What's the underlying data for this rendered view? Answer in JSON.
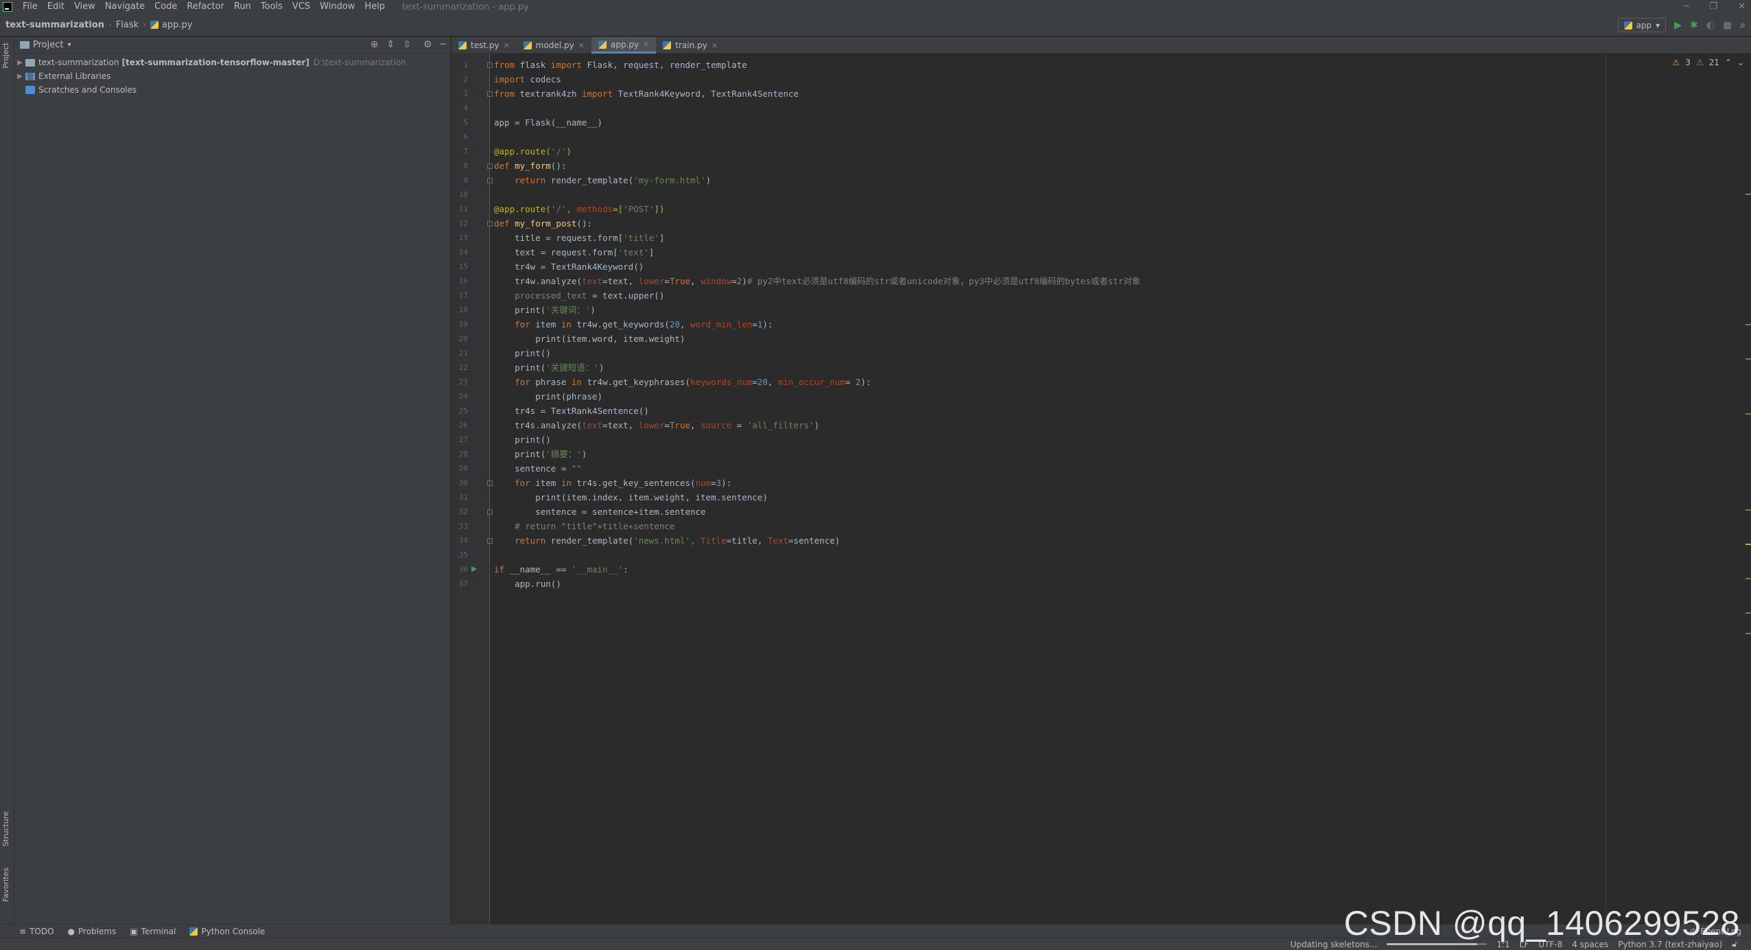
{
  "menu": {
    "items": [
      "File",
      "Edit",
      "View",
      "Navigate",
      "Code",
      "Refactor",
      "Run",
      "Tools",
      "VCS",
      "Window",
      "Help"
    ],
    "window_title": "text-summarization - app.py"
  },
  "navbar": {
    "project": "text-summarization",
    "folder": "Flask",
    "file": "app.py",
    "run_config": "app"
  },
  "side_tabs": {
    "project": "Project",
    "structure": "Structure",
    "favorites": "Favorites"
  },
  "project_panel": {
    "title": "Project",
    "tree": [
      {
        "name": "text-summarization",
        "bold": "[text-summarization-tensorflow-master]",
        "path": "D:\\text-summarization"
      },
      {
        "name": "External Libraries"
      },
      {
        "name": "Scratches and Consoles"
      }
    ]
  },
  "tabs": [
    {
      "label": "test.py",
      "active": false
    },
    {
      "label": "model.py",
      "active": false
    },
    {
      "label": "app.py",
      "active": true
    },
    {
      "label": "train.py",
      "active": false
    }
  ],
  "editor": {
    "warnings": "3",
    "weak_warnings": "21",
    "lines": [
      [
        [
          "from",
          "#cc7832"
        ],
        [
          " flask ",
          "#a9b7c6"
        ],
        [
          "import",
          "#cc7832"
        ],
        [
          " Flask, request, render_template",
          "#a9b7c6"
        ]
      ],
      [
        [
          "import",
          "#cc7832"
        ],
        [
          " codecs",
          "#a9b7c6"
        ]
      ],
      [
        [
          "from",
          "#cc7832"
        ],
        [
          " textrank4zh ",
          "#a9b7c6"
        ],
        [
          "import",
          "#cc7832"
        ],
        [
          " TextRank4Keyword, TextRank4Sentence",
          "#a9b7c6"
        ]
      ],
      [],
      [
        [
          "app = Flask(__name__)",
          "#a9b7c6"
        ]
      ],
      [],
      [
        [
          "@app.route(",
          "#bbb529"
        ],
        [
          "'/'",
          "#6a8759"
        ],
        [
          ")",
          "#bbb529"
        ]
      ],
      [
        [
          "def",
          "#cc7832"
        ],
        [
          " ",
          "#a9b7c6"
        ],
        [
          "my_form",
          "#ffc66d"
        ],
        [
          "():",
          "#a9b7c6"
        ]
      ],
      [
        [
          "    ",
          "#a9b7c6"
        ],
        [
          "return",
          "#cc7832"
        ],
        [
          " render_template(",
          "#a9b7c6"
        ],
        [
          "'my-form.html'",
          "#6a8759"
        ],
        [
          ")",
          "#a9b7c6"
        ]
      ],
      [],
      [
        [
          "@app.route(",
          "#bbb529"
        ],
        [
          "'/'",
          "#6a8759"
        ],
        [
          ", ",
          "#cc7832"
        ],
        [
          "methods",
          "#aa4926"
        ],
        [
          "=[",
          "#bbb529"
        ],
        [
          "'POST'",
          "#6a8759"
        ],
        [
          "])",
          "#bbb529"
        ]
      ],
      [
        [
          "def",
          "#cc7832"
        ],
        [
          " ",
          "#a9b7c6"
        ],
        [
          "my_form_post",
          "#ffc66d"
        ],
        [
          "():",
          "#a9b7c6"
        ]
      ],
      [
        [
          "    title = request.form[",
          "#a9b7c6"
        ],
        [
          "'title'",
          "#6a8759"
        ],
        [
          "]",
          "#a9b7c6"
        ]
      ],
      [
        [
          "    text = request.form[",
          "#a9b7c6"
        ],
        [
          "'text'",
          "#6a8759"
        ],
        [
          "]",
          "#a9b7c6"
        ]
      ],
      [
        [
          "    tr4w = TextRank4Keyword()",
          "#a9b7c6"
        ]
      ],
      [
        [
          "    tr4w.analyze(",
          "#a9b7c6"
        ],
        [
          "text",
          "#aa4926"
        ],
        [
          "=text, ",
          "#a9b7c6"
        ],
        [
          "lower",
          "#aa4926"
        ],
        [
          "=",
          "#a9b7c6"
        ],
        [
          "True",
          "#cc7832"
        ],
        [
          ", ",
          "#a9b7c6"
        ],
        [
          "window",
          "#aa4926"
        ],
        [
          "=",
          "#a9b7c6"
        ],
        [
          "2",
          "#6897bb"
        ],
        [
          ")",
          "#a9b7c6"
        ],
        [
          "# py2中text必须是utf8编码的str或者unicode对象，py3中必须是utf8编码的bytes或者str对象",
          "#808080"
        ]
      ],
      [
        [
          "    processed_text",
          "#808080"
        ],
        [
          " = text.upper()",
          "#a9b7c6"
        ]
      ],
      [
        [
          "    print(",
          "#a9b7c6"
        ],
        [
          "'关键词：'",
          "#6a8759"
        ],
        [
          ")",
          "#a9b7c6"
        ]
      ],
      [
        [
          "    ",
          "#a9b7c6"
        ],
        [
          "for",
          "#cc7832"
        ],
        [
          " item ",
          "#a9b7c6"
        ],
        [
          "in",
          "#cc7832"
        ],
        [
          " tr4w.get_keywords(",
          "#a9b7c6"
        ],
        [
          "20",
          "#6897bb"
        ],
        [
          ", ",
          "#a9b7c6"
        ],
        [
          "word_min_len",
          "#aa4926"
        ],
        [
          "=",
          "#a9b7c6"
        ],
        [
          "1",
          "#6897bb"
        ],
        [
          "):",
          "#a9b7c6"
        ]
      ],
      [
        [
          "        print(item.word, item.weight)",
          "#a9b7c6"
        ]
      ],
      [
        [
          "    print()",
          "#a9b7c6"
        ]
      ],
      [
        [
          "    print(",
          "#a9b7c6"
        ],
        [
          "'关键短语：'",
          "#6a8759"
        ],
        [
          ")",
          "#a9b7c6"
        ]
      ],
      [
        [
          "    ",
          "#a9b7c6"
        ],
        [
          "for",
          "#cc7832"
        ],
        [
          " phrase ",
          "#a9b7c6"
        ],
        [
          "in",
          "#cc7832"
        ],
        [
          " tr4w.get_keyphrases(",
          "#a9b7c6"
        ],
        [
          "keywords_num",
          "#aa4926"
        ],
        [
          "=",
          "#a9b7c6"
        ],
        [
          "20",
          "#6897bb"
        ],
        [
          ", ",
          "#a9b7c6"
        ],
        [
          "min_occur_num",
          "#aa4926"
        ],
        [
          "= ",
          "#a9b7c6"
        ],
        [
          "2",
          "#6897bb"
        ],
        [
          "):",
          "#a9b7c6"
        ]
      ],
      [
        [
          "        print(phrase)",
          "#a9b7c6"
        ]
      ],
      [
        [
          "    tr4s = TextRank4Sentence()",
          "#a9b7c6"
        ]
      ],
      [
        [
          "    tr4s.analyze(",
          "#a9b7c6"
        ],
        [
          "text",
          "#aa4926"
        ],
        [
          "=text, ",
          "#a9b7c6"
        ],
        [
          "lower",
          "#aa4926"
        ],
        [
          "=",
          "#a9b7c6"
        ],
        [
          "True",
          "#cc7832"
        ],
        [
          ", ",
          "#a9b7c6"
        ],
        [
          "source",
          "#aa4926"
        ],
        [
          " = ",
          "#a9b7c6"
        ],
        [
          "'all_filters'",
          "#6a8759"
        ],
        [
          ")",
          "#a9b7c6"
        ]
      ],
      [
        [
          "    print()",
          "#a9b7c6"
        ]
      ],
      [
        [
          "    print(",
          "#a9b7c6"
        ],
        [
          "'摘要：'",
          "#6a8759"
        ],
        [
          ")",
          "#a9b7c6"
        ]
      ],
      [
        [
          "    sentence = ",
          "#a9b7c6"
        ],
        [
          "\"\"",
          "#6a8759"
        ]
      ],
      [
        [
          "    ",
          "#a9b7c6"
        ],
        [
          "for",
          "#cc7832"
        ],
        [
          " item ",
          "#a9b7c6"
        ],
        [
          "in",
          "#cc7832"
        ],
        [
          " tr4s.get_key_sentences(",
          "#a9b7c6"
        ],
        [
          "num",
          "#aa4926"
        ],
        [
          "=",
          "#a9b7c6"
        ],
        [
          "3",
          "#6897bb"
        ],
        [
          "):",
          "#a9b7c6"
        ]
      ],
      [
        [
          "        print(item.index, item.weight, item.sentence)",
          "#a9b7c6"
        ]
      ],
      [
        [
          "        sentence = sentence+item.sentence",
          "#a9b7c6"
        ]
      ],
      [
        [
          "    # return \"title\"+title+sentence",
          "#808080"
        ]
      ],
      [
        [
          "    ",
          "#a9b7c6"
        ],
        [
          "return",
          "#cc7832"
        ],
        [
          " render_template(",
          "#a9b7c6"
        ],
        [
          "'news.html'",
          "#6a8759"
        ],
        [
          ", ",
          "#cc7832"
        ],
        [
          "Title",
          "#aa4926"
        ],
        [
          "=title, ",
          "#a9b7c6"
        ],
        [
          "Text",
          "#aa4926"
        ],
        [
          "=sentence)",
          "#a9b7c6"
        ]
      ],
      [],
      [
        [
          "if",
          "#cc7832"
        ],
        [
          " __name__ == ",
          "#a9b7c6"
        ],
        [
          "'__main__'",
          "#6a8759"
        ],
        [
          ":",
          "#a9b7c6"
        ]
      ],
      [
        [
          "    app.run()",
          "#a9b7c6"
        ]
      ]
    ]
  },
  "bottom_toolbar": [
    "TODO",
    "Problems",
    "Terminal",
    "Python Console"
  ],
  "status": {
    "task": "Updating skeletons...",
    "progress": 0.9,
    "position": "1:1",
    "line_sep": "LF",
    "encoding": "UTF-8",
    "indent": "4 spaces",
    "interpreter": "Python 3.7 (text-zhaiyao)"
  },
  "event_log": "Event Log",
  "watermark": "CSDN @qq_1406299528"
}
